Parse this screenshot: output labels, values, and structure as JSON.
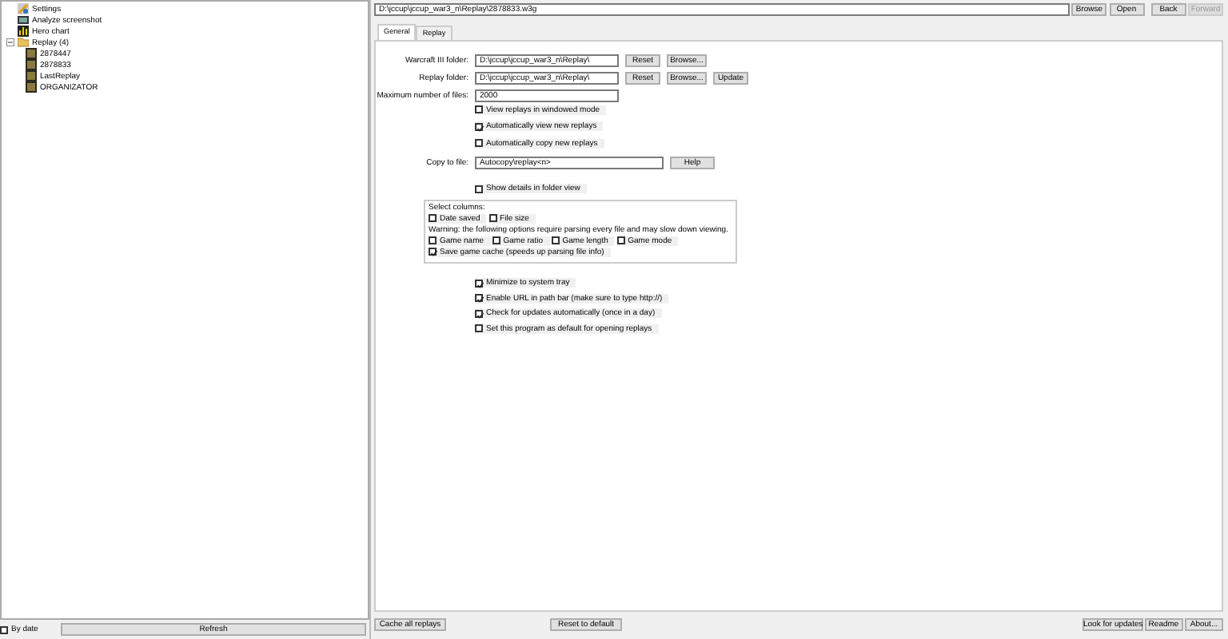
{
  "address_bar": {
    "value": "D:\\jccup\\jccup_war3_n\\Replay\\2878833.w3g"
  },
  "nav_buttons": [
    {
      "label": "Browse",
      "disabled": false
    },
    {
      "label": "Open",
      "disabled": false
    },
    {
      "label": "Back",
      "disabled": false
    },
    {
      "label": "Forward",
      "disabled": true
    }
  ],
  "tree": [
    {
      "kind": "settings",
      "label": "Settings"
    },
    {
      "kind": "screenshot",
      "label": "Analyze screenshot"
    },
    {
      "kind": "chart",
      "label": "Hero chart"
    },
    {
      "kind": "folder",
      "label": "Replay (4)",
      "expanded": true,
      "children": [
        {
          "kind": "replay",
          "label": "2878447"
        },
        {
          "kind": "replay",
          "label": "2878833"
        },
        {
          "kind": "replay",
          "label": "LastReplay"
        },
        {
          "kind": "replay",
          "label": "ORGANIZATOR"
        }
      ]
    }
  ],
  "by_date": {
    "label": "By date",
    "checked": false
  },
  "refresh_button": "Refresh",
  "tabs": [
    {
      "label": "General",
      "selected": true
    },
    {
      "label": "Replay",
      "selected": false
    }
  ],
  "folder_rows": [
    {
      "label": "Warcraft III folder:",
      "value": "D:\\jccup\\jccup_war3_n\\Replay\\",
      "buttons": [
        "Reset",
        "Browse..."
      ]
    },
    {
      "label": "Replay folder:",
      "value": "D:\\jccup\\jccup_war3_n\\Replay\\",
      "buttons": [
        "Reset",
        "Browse...",
        "Update"
      ]
    },
    {
      "label": "Maximum number of files:",
      "value": "2000",
      "buttons": []
    }
  ],
  "replay_options": [
    {
      "label": "View replays in windowed mode",
      "checked": false
    },
    {
      "label": "Automatically view new replays",
      "checked": true
    },
    {
      "label": "Automatically copy new replays",
      "checked": false
    }
  ],
  "copy_to_file": {
    "label": "Copy to file:",
    "value": "Autocopy\\replay<n>",
    "button": "Help"
  },
  "show_details": {
    "label": "Show details in folder view",
    "checked": false
  },
  "select_columns": {
    "title": "Select columns:",
    "basic": [
      {
        "label": "Date saved",
        "checked": false
      },
      {
        "label": "File size",
        "checked": false
      }
    ],
    "warning": "Warning: the following options require parsing every file and may slow down viewing.",
    "parsed": [
      {
        "label": "Game name",
        "checked": false
      },
      {
        "label": "Game ratio",
        "checked": false
      },
      {
        "label": "Game length",
        "checked": false
      },
      {
        "label": "Game mode",
        "checked": false
      }
    ],
    "cache": {
      "label": "Save game cache (speeds up parsing file info)",
      "checked": true
    }
  },
  "general_options": [
    {
      "label": "Minimize to system tray",
      "checked": true
    },
    {
      "label": "Enable URL in path bar (make sure to type http://)",
      "checked": true
    },
    {
      "label": "Check for updates automatically (once in a day)",
      "checked": true
    },
    {
      "label": "Set this program as default for opening replays",
      "checked": false
    }
  ],
  "bottom_left_buttons": [
    "Cache all replays",
    "Reset to default"
  ],
  "bottom_right_buttons": [
    "Look for updates",
    "Readme",
    "About..."
  ]
}
